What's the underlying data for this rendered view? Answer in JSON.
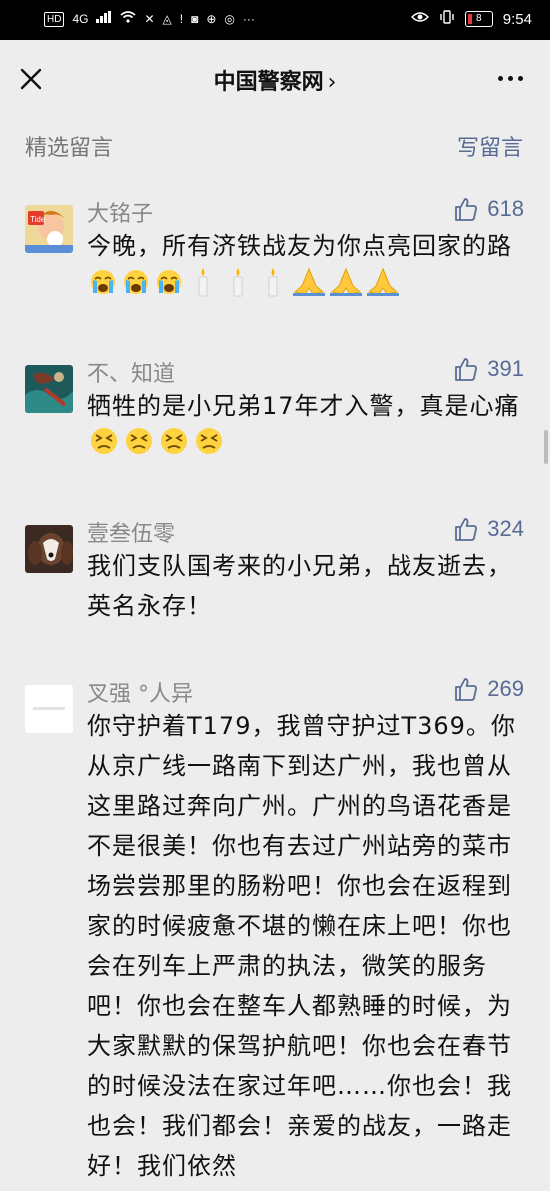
{
  "status_bar": {
    "hd": "HD",
    "signal": "4G",
    "battery": "8",
    "time": "9:54"
  },
  "nav": {
    "title": "中国警察网",
    "chevron": "›"
  },
  "section": {
    "title": "精选留言",
    "write": "写留言"
  },
  "comments": [
    {
      "name": "大铭子",
      "likes": "618",
      "text": "今晚，所有济铁战友为你点亮回家的路",
      "emojis": [
        "crying-face",
        "crying-face",
        "crying-face",
        "candle",
        "candle",
        "candle",
        "folded-hands",
        "folded-hands",
        "folded-hands"
      ]
    },
    {
      "name": "不、知道",
      "likes": "391",
      "text": "牺牲的是小兄弟17年才入警，真是心痛",
      "emojis": [
        "persevering-face",
        "persevering-face",
        "persevering-face",
        "persevering-face"
      ]
    },
    {
      "name": "壹叁伍零",
      "likes": "324",
      "text": "我们支队国考来的小兄弟，战友逝去，英名永存！"
    },
    {
      "name": "叉强 °人异",
      "likes": "269",
      "text": "你守护着T179，我曾守护过T369。你从京广线一路南下到达广州，我也曾从这里路过奔向广州。广州的鸟语花香是不是很美！你也有去过广州站旁的菜市场尝尝那里的肠粉吧！你也会在返程到家的时候疲惫不堪的懒在床上吧！你也会在列车上严肃的执法，微笑的服务吧！你也会在整车人都熟睡的时候，为大家默默的保驾护航吧！你也会在春节的时候没法在家过年吧……你也会！我也会！我们都会！亲爱的战友，一路走好！我们依然"
    }
  ],
  "colors": {
    "background": "#ededed",
    "link": "#576b95",
    "meta": "#888888"
  }
}
